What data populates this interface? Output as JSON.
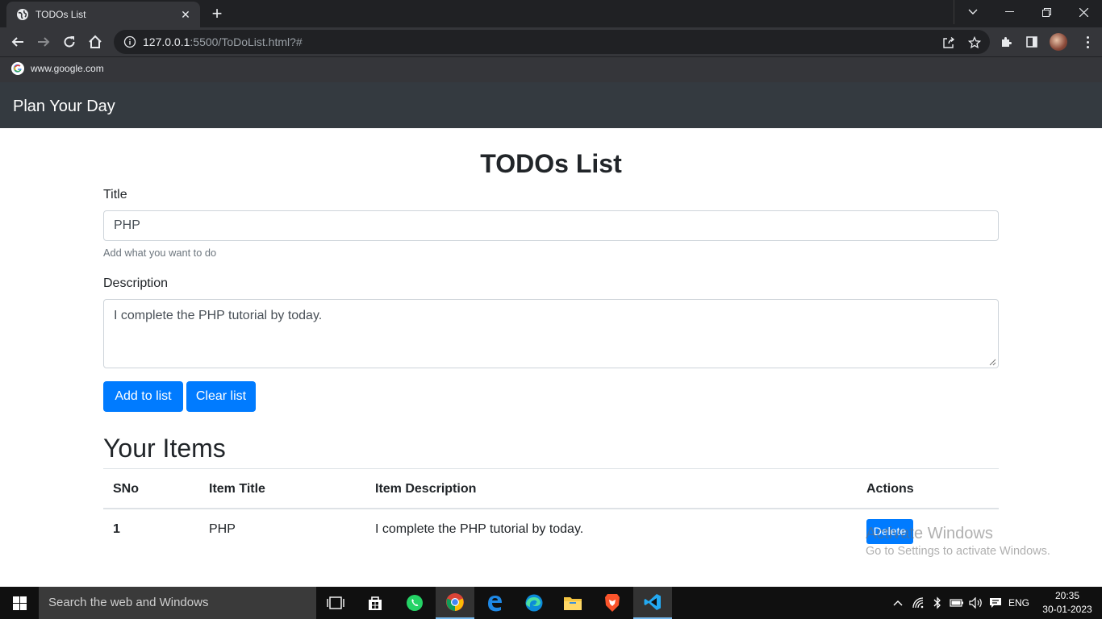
{
  "browser": {
    "tab_title": "TODOs List",
    "url_host": "127.0.0.1",
    "url_rest": ":5500/ToDoList.html?#",
    "bookmark_label": "www.google.com"
  },
  "navbar": {
    "brand": "Plan Your Day"
  },
  "form": {
    "heading": "TODOs List",
    "title_label": "Title",
    "title_value": "PHP",
    "title_help": "Add what you want to do",
    "description_label": "Description",
    "description_value": "I complete the PHP tutorial by today.",
    "add_button": "Add to list",
    "clear_button": "Clear list"
  },
  "items": {
    "heading": "Your Items",
    "columns": [
      "SNo",
      "Item Title",
      "Item Description",
      "Actions"
    ],
    "rows": [
      {
        "sno": "1",
        "title": "PHP",
        "description": "I complete the PHP tutorial by today.",
        "action": "Delete"
      }
    ]
  },
  "watermark": {
    "line1": "Activate Windows",
    "line2": "Go to Settings to activate Windows."
  },
  "taskbar": {
    "search_placeholder": "Search the web and Windows",
    "language": "ENG",
    "time": "20:35",
    "date": "30-01-2023"
  },
  "colors": {
    "primary": "#007bff",
    "navbar_bg": "#343a40",
    "chrome_frame": "#202124",
    "chrome_toolbar": "#35363a"
  }
}
